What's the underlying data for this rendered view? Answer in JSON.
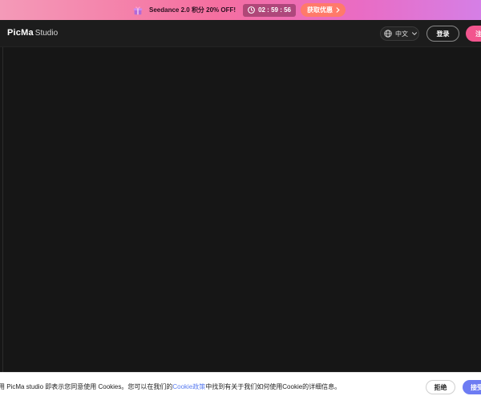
{
  "promo": {
    "icon": "gift-icon",
    "text": "Seedance 2.0 积分 20% OFF!",
    "timer": "02 : 59 : 56",
    "cta_label": "获取优惠",
    "colors": {
      "gradient_start": "#f49ab8",
      "gradient_end": "#d57fe6",
      "cta": "#ff7a6a"
    }
  },
  "header": {
    "logo_main": "PicMa",
    "logo_sub": "Studio",
    "language_label": "中文",
    "login_label": "登录",
    "register_label": "注",
    "colors": {
      "register": "#f2558e"
    }
  },
  "cookie": {
    "text_prefix": "用 PicMa studio 即表示您同意使用 Cookies。您可以在我们的",
    "link_label": "Cookie政策",
    "text_suffix": "中找到有关于我们如何使用Cookie的详细信息。",
    "reject_label": "拒绝",
    "accept_label": "接受",
    "colors": {
      "link": "#5a7cf0",
      "accept": "#6d7cf3"
    }
  }
}
